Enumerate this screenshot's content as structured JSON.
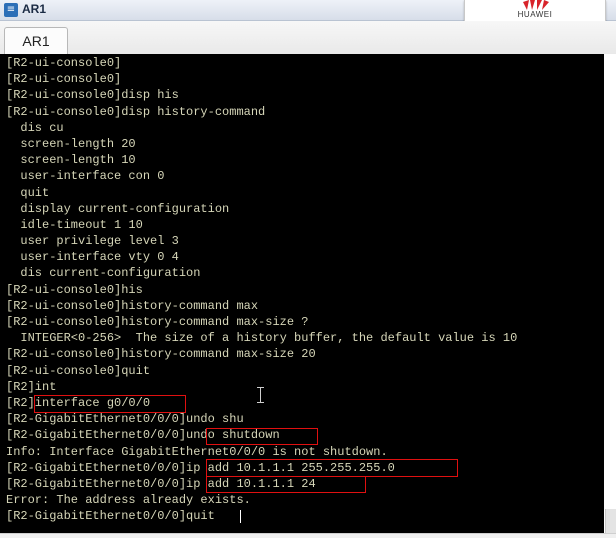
{
  "window": {
    "title": "AR1",
    "app_icon": "ensp-app-icon",
    "tab_label": "AR1",
    "logo_text": "HUAWEI"
  },
  "console": {
    "lines": [
      "[R2-ui-console0]",
      "[R2-ui-console0]",
      "[R2-ui-console0]disp his",
      "[R2-ui-console0]disp history-command",
      "  dis cu",
      "  screen-length 20",
      "  screen-length 10",
      "  user-interface con 0",
      "  quit",
      "  display current-configuration",
      "  idle-timeout 1 10",
      "  user privilege level 3",
      "  user-interface vty 0 4",
      "  dis current-configuration",
      "[R2-ui-console0]his",
      "[R2-ui-console0]history-command max",
      "[R2-ui-console0]history-command max-size ?",
      "  INTEGER<0-256>  The size of a history buffer, the default value is 10",
      "[R2-ui-console0]history-command max-size 20",
      "[R2-ui-console0]quit",
      "[R2]int",
      "[R2]interface g0/0/0",
      "[R2-GigabitEthernet0/0/0]undo shu",
      "[R2-GigabitEthernet0/0/0]undo shutdown",
      "Info: Interface GigabitEthernet0/0/0 is not shutdown.",
      "[R2-GigabitEthernet0/0/0]ip add 10.1.1.1 255.255.255.0",
      "[R2-GigabitEthernet0/0/0]ip add 10.1.1.1 24",
      "Error: The address already exists.",
      "[R2-GigabitEthernet0/0/0]quit"
    ],
    "highlight_color": "#e01010",
    "text_color": "#d6d6b8"
  }
}
